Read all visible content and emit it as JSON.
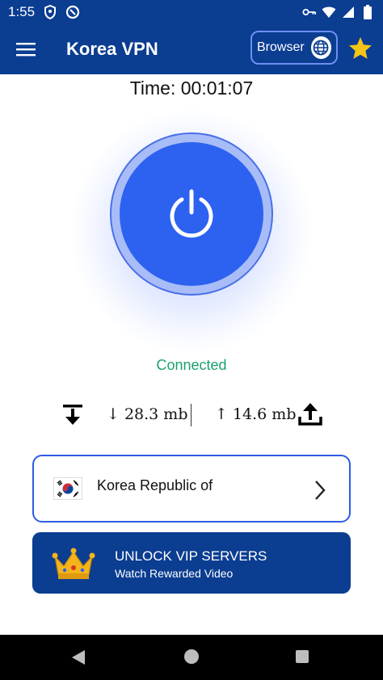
{
  "status_bar": {
    "time": "1:55"
  },
  "app_bar": {
    "title": "Korea VPN",
    "browser_label": "Browser"
  },
  "timer": {
    "text": "Time: 00:01:07"
  },
  "connection": {
    "status": "Connected"
  },
  "traffic": {
    "download": "↓ 28.3 mb",
    "upload": "↑ 14.6 mb"
  },
  "server": {
    "name": "Korea Republic of"
  },
  "vip": {
    "title": "UNLOCK VIP SERVERS",
    "subtitle": "Watch Rewarded Video"
  },
  "colors": {
    "app_bar": "#0b3d91",
    "power_button": "#2d62f0",
    "connected": "#1aa36a",
    "card_border": "#2d5be3",
    "star": "#f5c518",
    "crown": "#f4b41a"
  }
}
